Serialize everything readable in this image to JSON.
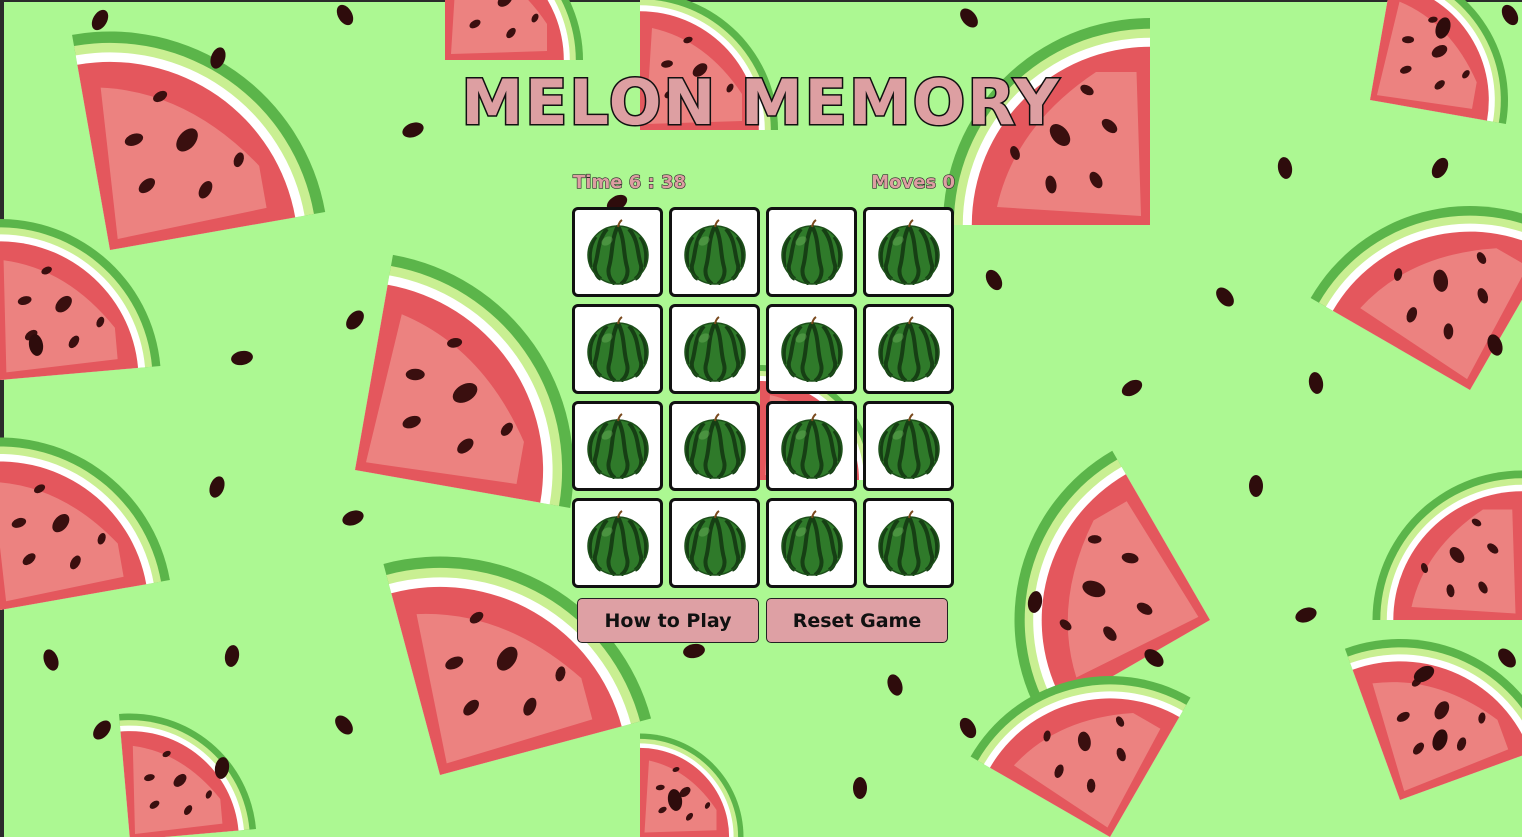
{
  "app": {
    "title": "MELON MEMORY"
  },
  "stats": {
    "time_label": "Time",
    "time_value": "6 : 38",
    "moves_label": "Moves",
    "moves_value": "0"
  },
  "board": {
    "rows": 4,
    "columns": 4,
    "cards": [
      {
        "state": "face-down",
        "icon": "watermelon-icon"
      },
      {
        "state": "face-down",
        "icon": "watermelon-icon"
      },
      {
        "state": "face-down",
        "icon": "watermelon-icon"
      },
      {
        "state": "face-down",
        "icon": "watermelon-icon"
      },
      {
        "state": "face-down",
        "icon": "watermelon-icon"
      },
      {
        "state": "face-down",
        "icon": "watermelon-icon"
      },
      {
        "state": "face-down",
        "icon": "watermelon-icon"
      },
      {
        "state": "face-down",
        "icon": "watermelon-icon"
      },
      {
        "state": "face-down",
        "icon": "watermelon-icon"
      },
      {
        "state": "face-down",
        "icon": "watermelon-icon"
      },
      {
        "state": "face-down",
        "icon": "watermelon-icon"
      },
      {
        "state": "face-down",
        "icon": "watermelon-icon"
      },
      {
        "state": "face-down",
        "icon": "watermelon-icon"
      },
      {
        "state": "face-down",
        "icon": "watermelon-icon"
      },
      {
        "state": "face-down",
        "icon": "watermelon-icon"
      },
      {
        "state": "face-down",
        "icon": "watermelon-icon"
      }
    ]
  },
  "buttons": {
    "how_to_play": "How to Play",
    "reset_game": "Reset Game"
  },
  "colors": {
    "background": "#acf892",
    "accent_pink": "#dd9fa2",
    "melon_flesh": "#e4575d",
    "melon_rind": "#5bb54a",
    "card_face": "#ffffff"
  }
}
